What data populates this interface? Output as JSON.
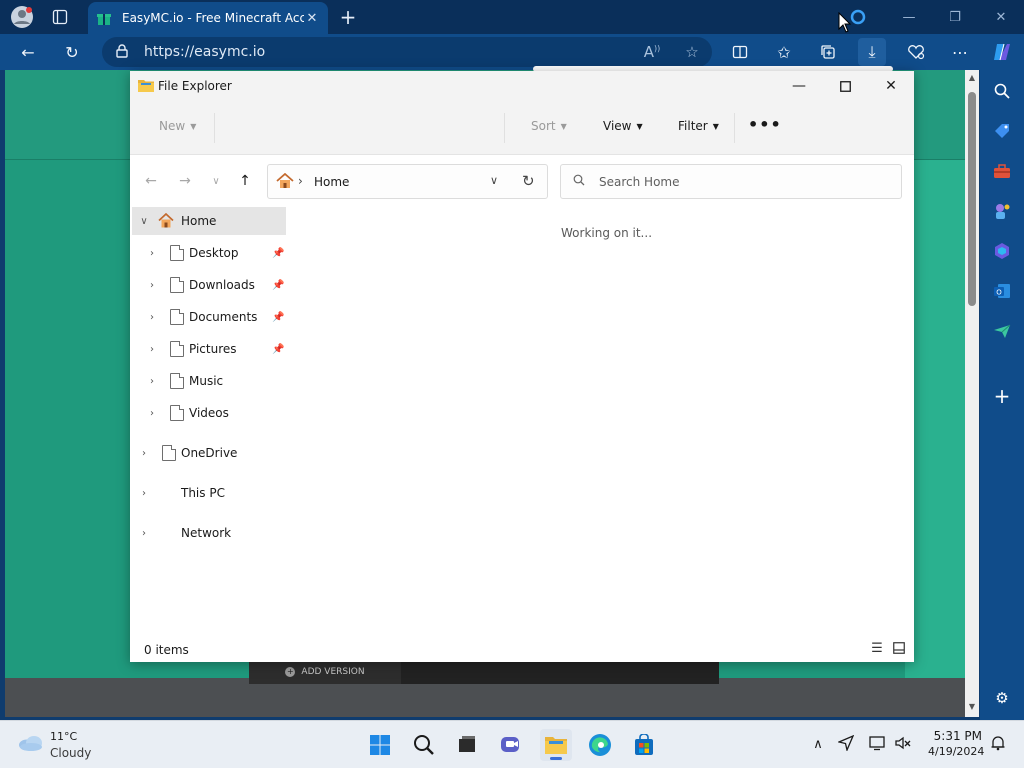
{
  "browser": {
    "tab": {
      "title": "EasyMC.io - Free Minecraft Acco"
    },
    "address": {
      "url": "https://easymc.io"
    }
  },
  "page": {
    "add_version_label": "ADD VERSION"
  },
  "explorer": {
    "title": "File Explorer",
    "commands": {
      "new": "New",
      "sort": "Sort",
      "view": "View",
      "filter": "Filter"
    },
    "breadcrumb": "Home",
    "search_placeholder": "Search Home",
    "nav_items": [
      {
        "label": "Home"
      },
      {
        "label": "Desktop"
      },
      {
        "label": "Downloads"
      },
      {
        "label": "Documents"
      },
      {
        "label": "Pictures"
      },
      {
        "label": "Music"
      },
      {
        "label": "Videos"
      },
      {
        "label": "OneDrive"
      },
      {
        "label": "This PC"
      },
      {
        "label": "Network"
      }
    ],
    "content_status": "Working on it...",
    "status_count": "0 items"
  },
  "taskbar": {
    "weather": {
      "temp": "11°C",
      "condition": "Cloudy"
    },
    "clock": {
      "time": "5:31 PM",
      "date": "4/19/2024"
    }
  },
  "colors": {
    "browser_accent": "#104c8a",
    "page_green": "#1f9a7d",
    "home_icon": "#c46a2e",
    "taskbar_indicator": "#3a6fd8"
  }
}
